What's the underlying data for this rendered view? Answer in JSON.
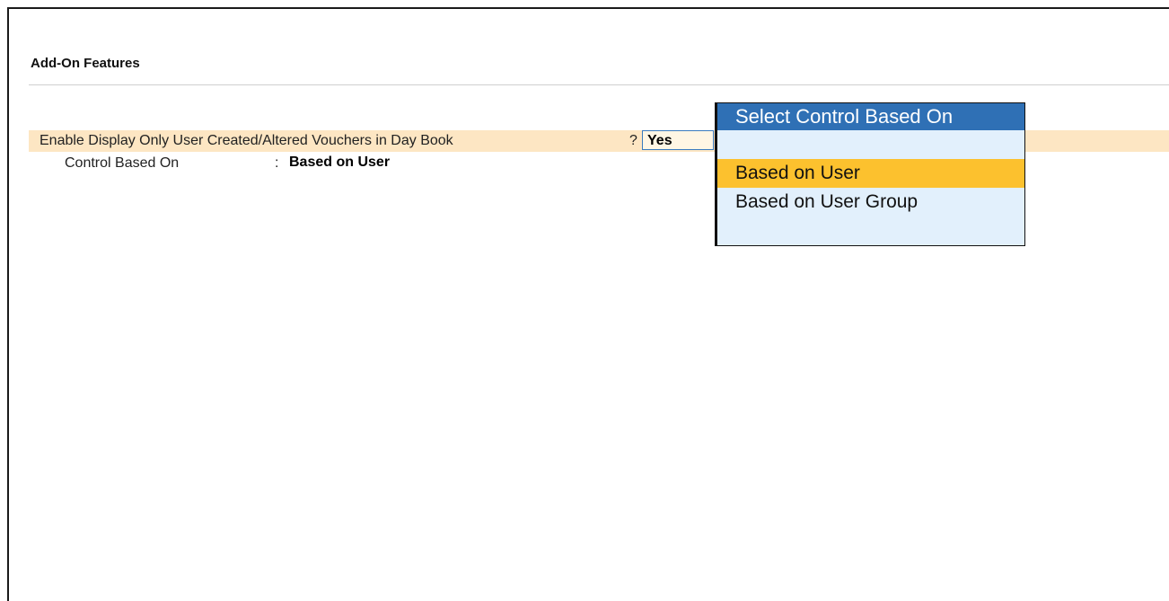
{
  "section": {
    "title": "Add-On Features"
  },
  "feature": {
    "label": "Enable Display Only User Created/Altered Vouchers in Day Book",
    "separator": "?",
    "value": "Yes"
  },
  "control": {
    "label": "Control Based On",
    "separator": ":",
    "value": "Based on User"
  },
  "popup": {
    "title": "Select Control Based On",
    "options": [
      {
        "label": "Based on User",
        "selected": true
      },
      {
        "label": "Based on User Group",
        "selected": false
      }
    ]
  },
  "colors": {
    "row_highlight": "#fde6c3",
    "popup_header": "#2f70b5",
    "popup_background": "#e2f0fc",
    "selected_option": "#fcc12e"
  }
}
